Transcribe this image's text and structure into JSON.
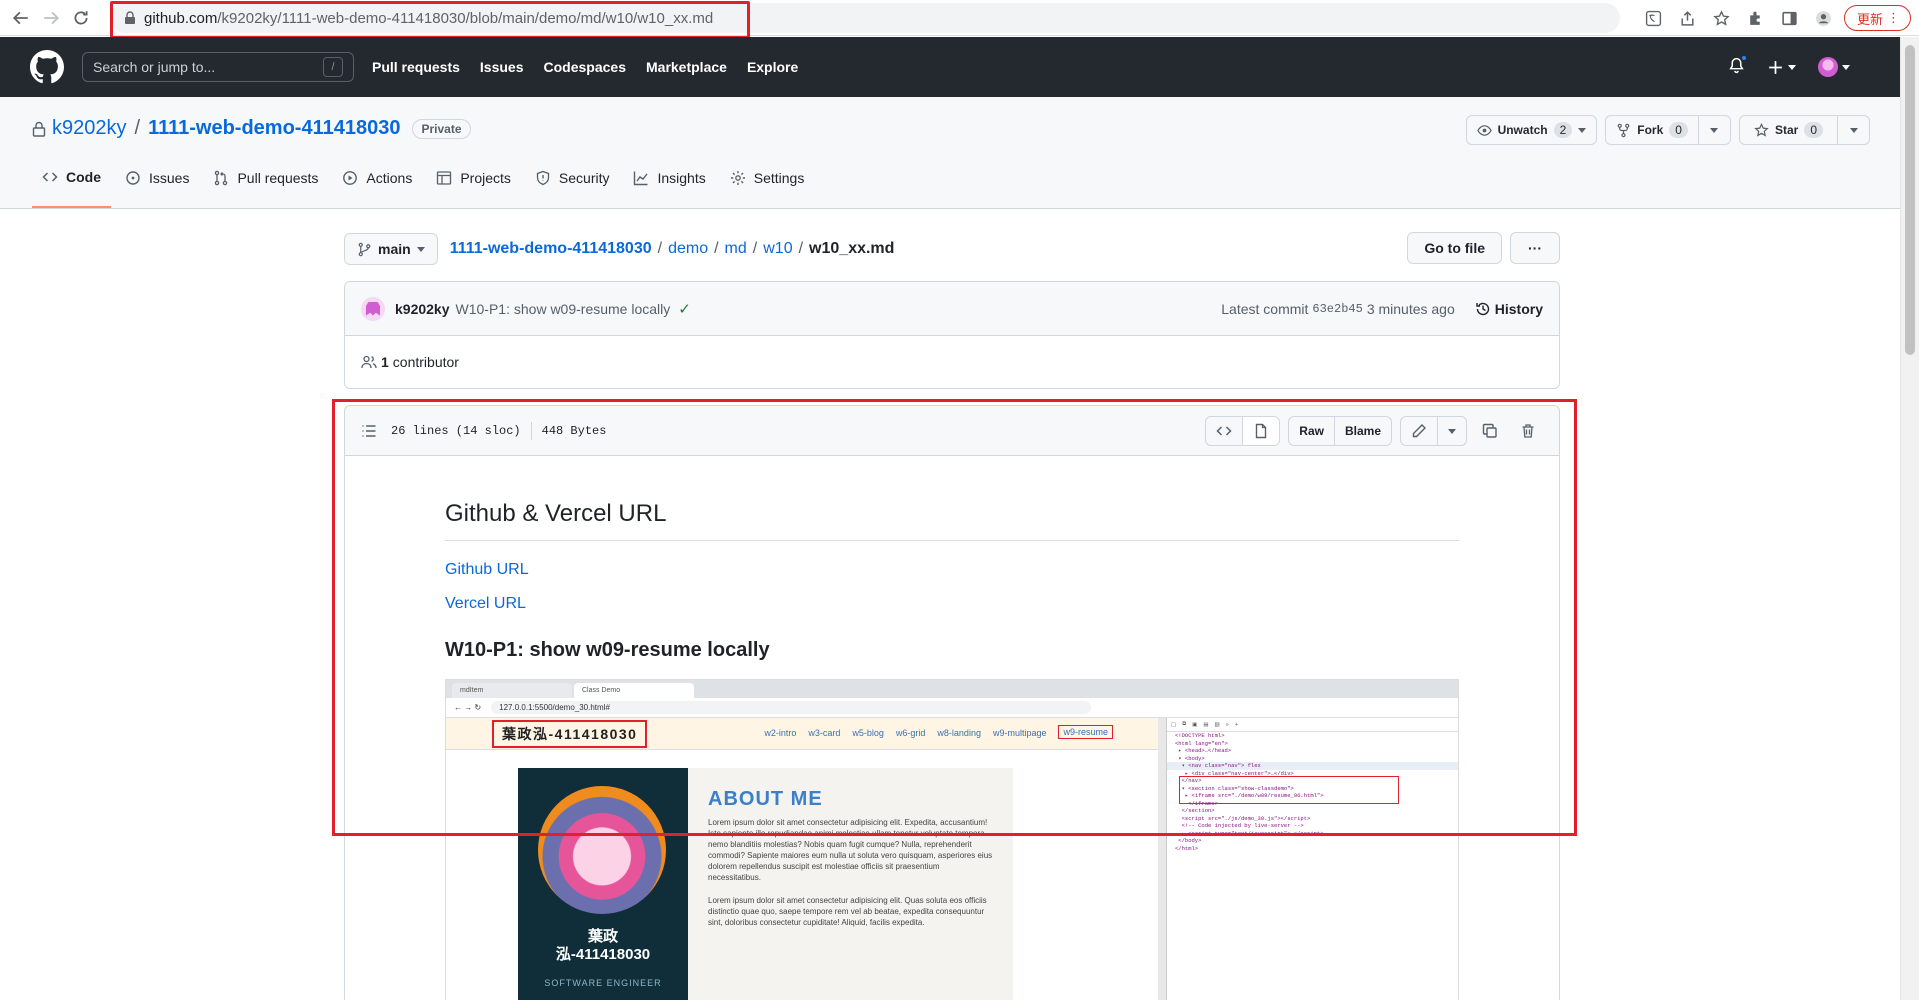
{
  "browser": {
    "url_host": "github.com",
    "url_path": "/k9202ky/1111-web-demo-411418030/blob/main/demo/md/w10/w10_xx.md",
    "update_label": "更新"
  },
  "header": {
    "search_placeholder": "Search or jump to...",
    "search_key": "/",
    "nav": [
      "Pull requests",
      "Issues",
      "Codespaces",
      "Marketplace",
      "Explore"
    ]
  },
  "repo": {
    "owner": "k9202ky",
    "name": "1111-web-demo-411418030",
    "visibility": "Private",
    "watch_label": "Unwatch",
    "watch_count": "2",
    "fork_label": "Fork",
    "fork_count": "0",
    "star_label": "Star",
    "star_count": "0",
    "tabs": [
      "Code",
      "Issues",
      "Pull requests",
      "Actions",
      "Projects",
      "Security",
      "Insights",
      "Settings"
    ]
  },
  "file_nav": {
    "branch": "main",
    "crumbs": [
      "1111-web-demo-411418030",
      "demo",
      "md",
      "w10"
    ],
    "current": "w10_xx.md",
    "go_to_file": "Go to file",
    "more": "···"
  },
  "commit": {
    "author": "k9202ky",
    "message": "W10-P1: show w09-resume locally",
    "latest_label": "Latest commit",
    "sha": "63e2b45",
    "time": "3 minutes ago",
    "history_label": "History",
    "contributors_count": "1",
    "contributors_label": "contributor"
  },
  "file": {
    "lines": "26 lines (14 sloc)",
    "size": "448 Bytes",
    "raw_label": "Raw",
    "blame_label": "Blame"
  },
  "markdown": {
    "h2": "Github & Vercel URL",
    "link1": "Github URL",
    "link2": "Vercel URL",
    "h3": "W10-P1: show w09-resume locally"
  },
  "embedded": {
    "tab1": "mdItem",
    "tab2": "Class Demo",
    "url": "127.0.0.1:5500/demo_30.html#",
    "name": "葉政泓-411418030",
    "links": [
      "w2-intro",
      "w3-card",
      "w5-blog",
      "w6-grid",
      "w8-landing",
      "w9-multipage",
      "w9-resume"
    ],
    "card_name_line1": "葉政",
    "card_name_line2": "泓-411418030",
    "role": "SOFTWARE ENGINEER",
    "about": "ABOUT ME",
    "para1": "Lorem ipsum dolor sit amet consectetur adipisicing elit. Expedita, accusantium! Iste sapiente illo repudiandae animi molestiae ullam tenetur voluptate tempora nemo blanditiis molestias? Nobis quam fugit cumque? Nulla, reprehenderit commodi? Sapiente maiores eum nulla ut soluta vero quisquam, asperiores eius dolorem repellendus suscipit est molestiae officiis sit praesentium necessitatibus.",
    "para2": "Lorem ipsum dolor sit amet consectetur adipisicing elit. Quas soluta eos officiis distinctio quae quo, saepe tempore rem vel ab beatae, expedita consequuntur sint, doloribus consectetur cupiditate! Aliquid, facilis expedita."
  },
  "colors": {
    "header_bg": "#24292f",
    "link": "#0969da",
    "highlight_red": "#e0202a",
    "active_tab": "#fd8c73"
  }
}
